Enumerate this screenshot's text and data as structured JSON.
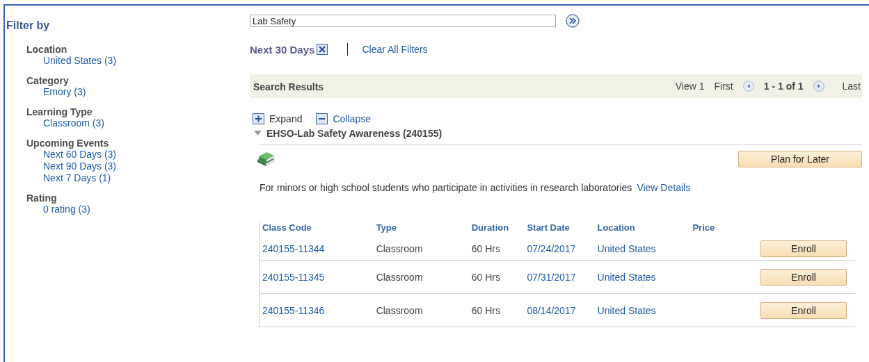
{
  "sidebar": {
    "title": "Filter by",
    "groups": [
      {
        "label": "Location",
        "items": [
          "United States (3)"
        ]
      },
      {
        "label": "Category",
        "items": [
          "Emory (3)"
        ]
      },
      {
        "label": "Learning Type",
        "items": [
          "Classroom (3)"
        ]
      },
      {
        "label": "Upcoming Events",
        "items": [
          "Next 60 Days (3)",
          "Next 90 Days (3)",
          "Next 7 Days (1)"
        ]
      },
      {
        "label": "Rating",
        "items": [
          "0 rating (3)"
        ]
      }
    ]
  },
  "search": {
    "value": "Lab Safety"
  },
  "active_filter": {
    "label": "Next 30 Days",
    "clear_all": "Clear All Filters"
  },
  "results": {
    "title": "Search Results",
    "view": "View 1",
    "first": "First",
    "range": "1 - 1 of 1",
    "last": "Last",
    "expand": "Expand",
    "collapse": "Collapse",
    "course": {
      "title": "EHSO-Lab Safety Awareness (240155)",
      "expanded": true,
      "plan_button": "Plan for Later",
      "description": "For minors or high school students who participate in activities in research laboratories",
      "details_link": "View Details",
      "columns": [
        "Class Code",
        "Type",
        "Duration",
        "Start Date",
        "Location",
        "Price"
      ],
      "rows": [
        {
          "code": "240155-11344",
          "type": "Classroom",
          "duration": "60 Hrs",
          "start": "07/24/2017",
          "location": "United States",
          "button": "Enroll"
        },
        {
          "code": "240155-11345",
          "type": "Classroom",
          "duration": "60 Hrs",
          "start": "07/31/2017",
          "location": "United States",
          "button": "Enroll"
        },
        {
          "code": "240155-11346",
          "type": "Classroom",
          "duration": "60 Hrs",
          "start": "08/14/2017",
          "location": "United States",
          "button": "Enroll"
        }
      ]
    }
  }
}
